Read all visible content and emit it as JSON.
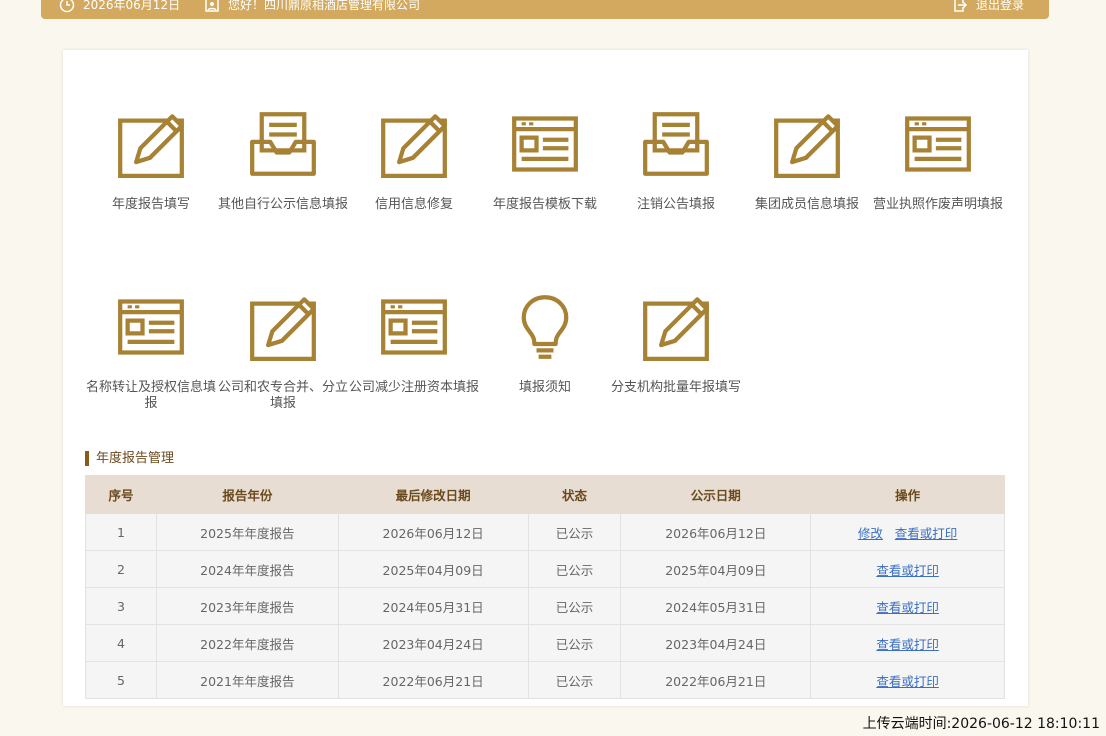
{
  "header": {
    "date": "2026年06月12日",
    "greeting": "您好！四川鼎原相酒店管理有限公司",
    "logout": "退出登录"
  },
  "tiles": [
    {
      "label": "年度报告填写",
      "icon": "edit-icon"
    },
    {
      "label": "其他自行公示信息填报",
      "icon": "inbox-icon"
    },
    {
      "label": "信用信息修复",
      "icon": "edit-icon"
    },
    {
      "label": "年度报告模板下载",
      "icon": "form-icon"
    },
    {
      "label": "注销公告填报",
      "icon": "inbox-icon"
    },
    {
      "label": "集团成员信息填报",
      "icon": "edit-icon"
    },
    {
      "label": "营业执照作废声明填报",
      "icon": "form-icon"
    },
    {
      "label": "名称转让及授权信息填报",
      "icon": "form-icon"
    },
    {
      "label": "公司和农专合并、分立填报",
      "icon": "edit-icon"
    },
    {
      "label": "公司减少注册资本填报",
      "icon": "form-icon"
    },
    {
      "label": "填报须知",
      "icon": "lightbulb-icon"
    },
    {
      "label": "分支机构批量年报填写",
      "icon": "edit-icon"
    }
  ],
  "section": {
    "title": "年度报告管理"
  },
  "table": {
    "headers": [
      "序号",
      "报告年份",
      "最后修改日期",
      "状态",
      "公示日期",
      "操作"
    ],
    "rows": [
      {
        "no": "1",
        "year": "2025年年度报告",
        "modified": "2026年06月12日",
        "status": "已公示",
        "published": "2026年06月12日",
        "edit": "修改",
        "view": "查看或打印"
      },
      {
        "no": "2",
        "year": "2024年年度报告",
        "modified": "2025年04月09日",
        "status": "已公示",
        "published": "2025年04月09日",
        "view": "查看或打印"
      },
      {
        "no": "3",
        "year": "2023年年度报告",
        "modified": "2024年05月31日",
        "status": "已公示",
        "published": "2024年05月31日",
        "view": "查看或打印"
      },
      {
        "no": "4",
        "year": "2022年年度报告",
        "modified": "2023年04月24日",
        "status": "已公示",
        "published": "2023年04月24日",
        "view": "查看或打印"
      },
      {
        "no": "5",
        "year": "2021年年度报告",
        "modified": "2022年06月21日",
        "status": "已公示",
        "published": "2022年06月21日",
        "view": "查看或打印"
      }
    ]
  },
  "footer": {
    "upload_time": "上传云端时间:2026-06-12 18:10:11"
  },
  "colors": {
    "accent": "#a88234",
    "topbar": "#d2a95e",
    "link": "#3a6fc2"
  }
}
